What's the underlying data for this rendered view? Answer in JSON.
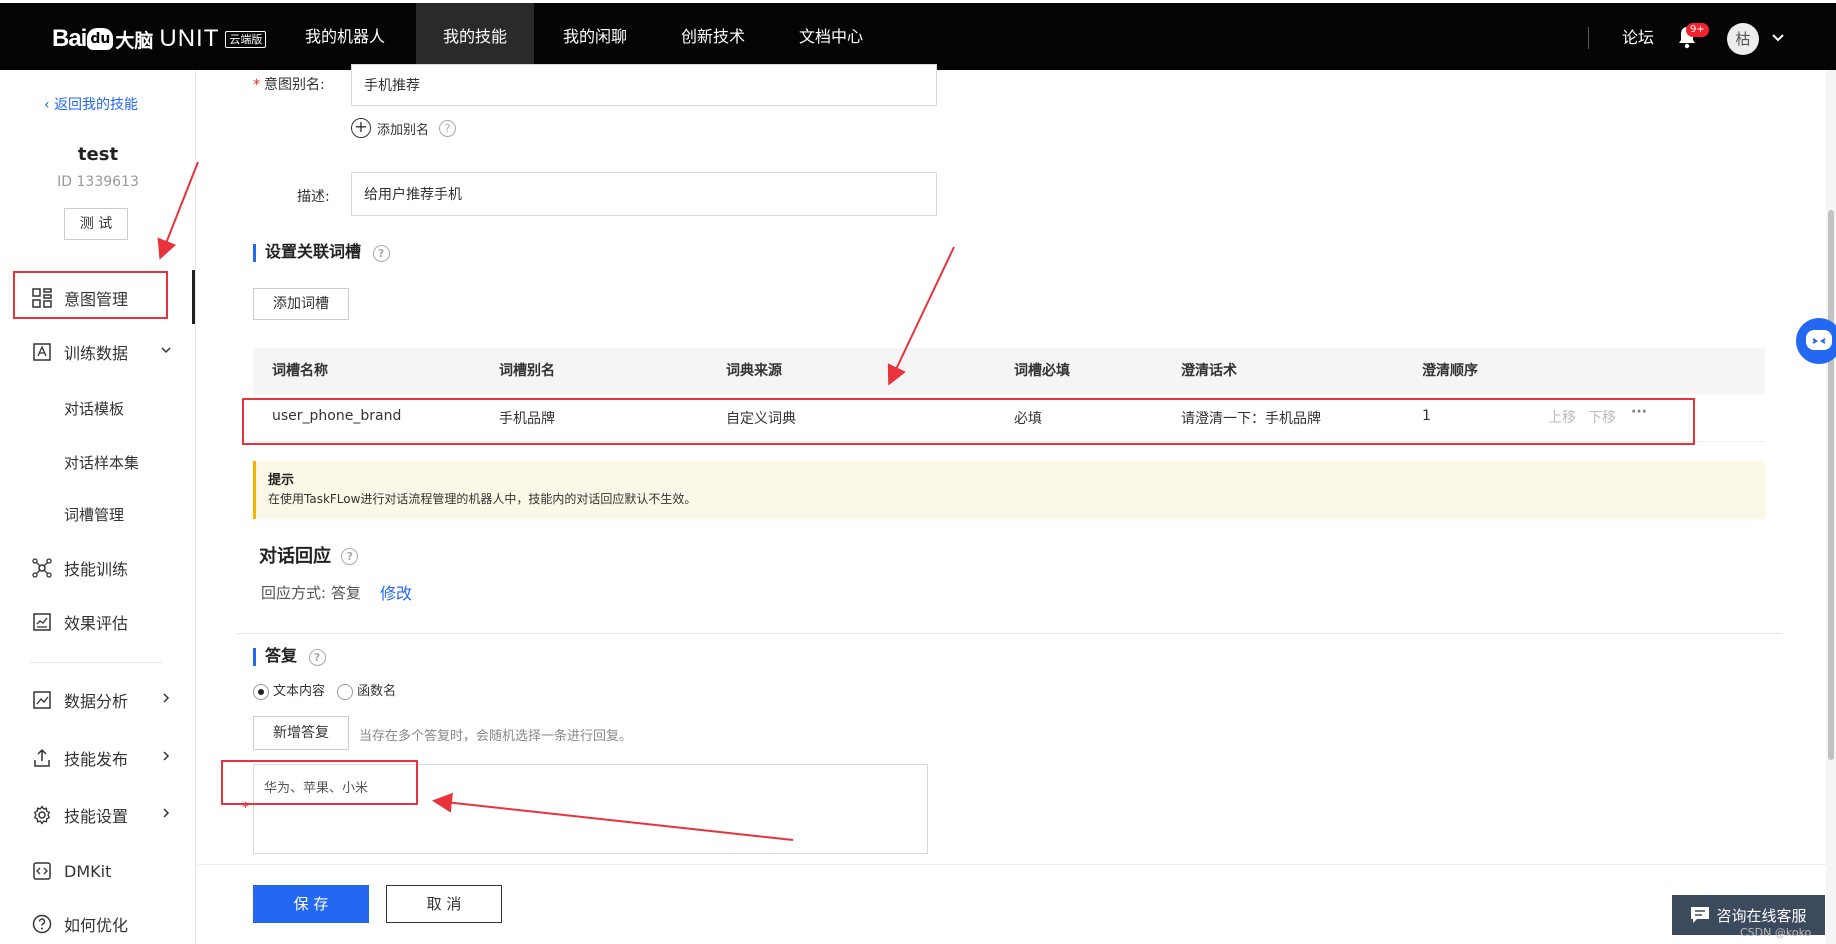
{
  "brand": {
    "bai": "Bai",
    "paw": "du",
    "danao": "大脑",
    "unit": "UNIT",
    "edition": "云端版"
  },
  "nav": {
    "items": [
      "我的机器人",
      "我的技能",
      "我的闲聊",
      "创新技术",
      "文档中心"
    ],
    "active": "我的技能",
    "forum": "论坛",
    "badge": "9+",
    "avatar": "枯"
  },
  "sidebar": {
    "back": "返回我的技能",
    "bot_name": "test",
    "bot_id": "ID 1339613",
    "test_button": "测 试",
    "menu": {
      "intent": "意图管理",
      "train_data": "训练数据",
      "dialog_template": "对话模板",
      "dialog_samples": "对话样本集",
      "slot_mgmt": "词槽管理",
      "skill_training": "技能训练",
      "evaluation": "效果评估",
      "analytics": "数据分析",
      "publish": "技能发布",
      "settings": "技能设置",
      "dmkit": "DMKit",
      "optimize": "如何优化"
    }
  },
  "form": {
    "alias_label": "意图别名:",
    "alias_value": "手机推荐",
    "add_alias": "添加别名",
    "desc_label": "描述:",
    "desc_value": "给用户推荐手机"
  },
  "slots": {
    "title": "设置关联词槽",
    "add_button": "添加词槽",
    "headers": [
      "词槽名称",
      "词槽别名",
      "词典来源",
      "词槽必填",
      "澄清话术",
      "澄清顺序"
    ],
    "row": {
      "name": "user_phone_brand",
      "alias": "手机品牌",
      "source": "自定义词典",
      "required": "必填",
      "clarify": "请澄清一下：手机品牌",
      "order": "1",
      "up": "上移",
      "down": "下移",
      "more": "···"
    }
  },
  "tip": {
    "title": "提示",
    "text": "在使用TaskFLow进行对话流程管理的机器人中，技能内的对话回应默认不生效。"
  },
  "response": {
    "title": "对话回应",
    "mode_label": "回应方式: 答复",
    "modify": "修改"
  },
  "answer": {
    "title": "答复",
    "option_text": "文本内容",
    "option_func": "函数名",
    "add_button": "新增答复",
    "hint": "当存在多个答复时，会随机选择一条进行回复。",
    "content": "华为、苹果、小米"
  },
  "footer": {
    "save": "保 存",
    "cancel": "取 消"
  },
  "float": {
    "consult": "咨询在线客服",
    "watermark": "CSDN @koko"
  }
}
